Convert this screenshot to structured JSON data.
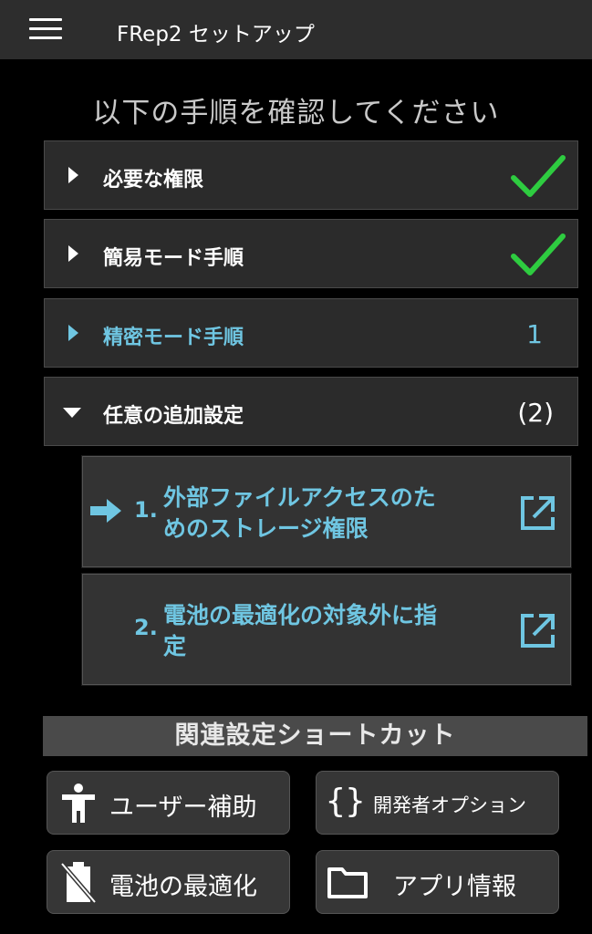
{
  "appbar": {
    "title": "FRep2 セットアップ",
    "menu_icon": "hamburger-menu-icon"
  },
  "heading": "以下の手順を確認してください",
  "steps": [
    {
      "label": "必要な権限",
      "state": "collapsed",
      "status": "check"
    },
    {
      "label": "簡易モード手順",
      "state": "collapsed",
      "status": "check"
    },
    {
      "label": "精密モード手順",
      "state": "collapsed",
      "count": "1",
      "highlight": true
    },
    {
      "label": "任意の追加設定",
      "state": "expanded",
      "count": "(2)"
    }
  ],
  "optional_items": [
    {
      "num": "1.",
      "line1": "外部ファイルアクセスのた",
      "line2": "めのストレージ権限",
      "current": true
    },
    {
      "num": "2.",
      "line1": "電池の最適化の対象外に指",
      "line2": "定",
      "current": false
    }
  ],
  "shortcuts": {
    "header": "関連設定ショートカット",
    "buttons": [
      {
        "label": "ユーザー補助",
        "icon": "accessibility-icon"
      },
      {
        "label": "開発者オプション",
        "icon": "curly-braces-icon"
      },
      {
        "label": "電池の最適化",
        "icon": "battery-off-icon"
      },
      {
        "label": "アプリ情報",
        "icon": "folder-icon"
      }
    ]
  },
  "colors": {
    "accent": "#6fc6e2",
    "check": "#2ecc40",
    "bar": "#2d2d2d"
  }
}
